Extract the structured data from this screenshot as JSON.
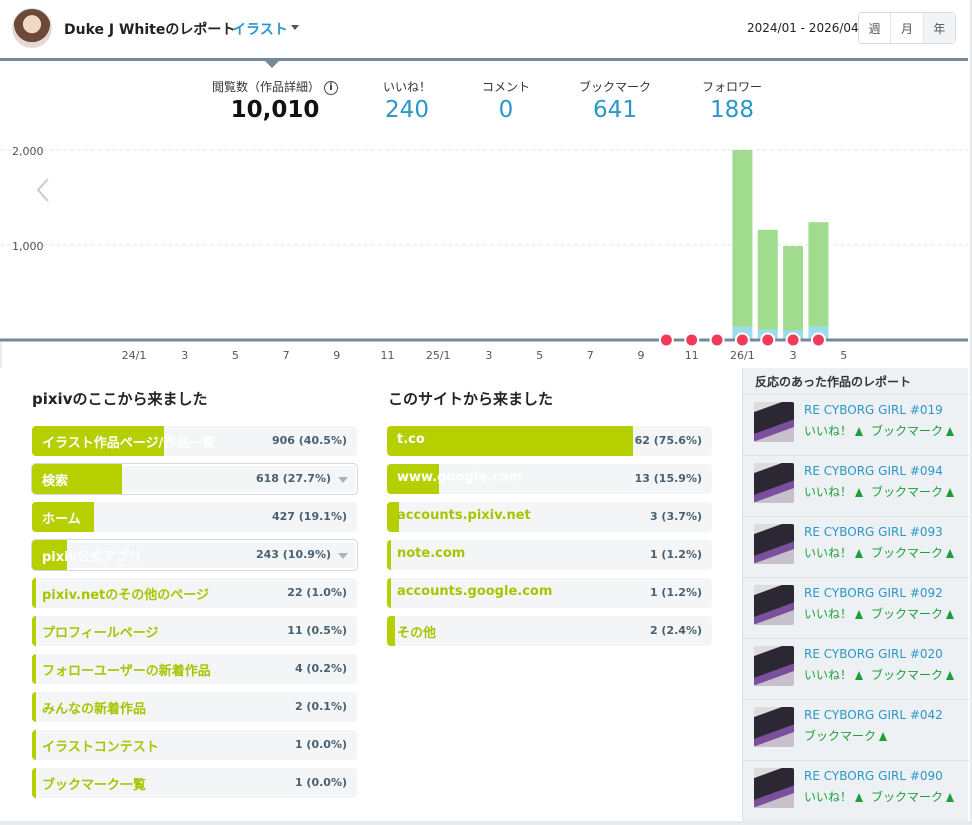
{
  "header": {
    "report_title": "Duke J Whiteのレポート",
    "category": "イラスト",
    "date_range": "2024/01 - 2026/04",
    "period_buttons": [
      "週",
      "月",
      "年"
    ],
    "active_period": "年"
  },
  "summary": {
    "views_label": "閲覧数（作品詳細）",
    "views_value": "10,010",
    "likes_label": "いいね！",
    "likes_value": "240",
    "comments_label": "コメント",
    "comments_value": "0",
    "bookmarks_label": "ブックマーク",
    "bookmarks_value": "641",
    "followers_label": "フォロワー",
    "followers_value": "188"
  },
  "chart_data": {
    "type": "bar",
    "ylim": [
      0,
      2000
    ],
    "y_ticks": [
      "2,000",
      "1,000"
    ],
    "y_tick_values": [
      2000,
      1000
    ],
    "x_tick_labels": [
      "24/1",
      "3",
      "5",
      "7",
      "9",
      "11",
      "25/1",
      "3",
      "5",
      "7",
      "9",
      "11",
      "26/1",
      "3",
      "5"
    ],
    "categories": [
      "25/11",
      "25/12",
      "26/1",
      "26/2",
      "26/3",
      "26/4"
    ],
    "series": [
      {
        "values": [
          0,
          0,
          2000,
          1160,
          990,
          1240
        ],
        "color": "#a0db8e"
      },
      {
        "values": [
          0,
          0,
          140,
          110,
          100,
          140
        ],
        "color": "#9bdcf0"
      }
    ],
    "grid": true,
    "event_markers": [
      "25/10",
      "25/11",
      "25/12",
      "26/1",
      "26/2",
      "26/3",
      "26/4"
    ],
    "marker_color": "#f03c5a"
  },
  "referrers_pixiv": {
    "title": "pixivのここから来ました",
    "rows": [
      {
        "label": "イラスト作品ページ/作品一覧",
        "stat": "906 (40.5%)",
        "pct": 40.5,
        "caret": false
      },
      {
        "label": "検索",
        "stat": "618 (27.7%)",
        "pct": 27.7,
        "caret": true
      },
      {
        "label": "ホーム",
        "stat": "427 (19.1%)",
        "pct": 19.1,
        "caret": false
      },
      {
        "label": "pixiv公式アプリ",
        "stat": "243 (10.9%)",
        "pct": 10.9,
        "caret": true
      },
      {
        "label": "pixiv.netのその他のページ",
        "stat": "22 (1.0%)",
        "pct": 1.0,
        "caret": false
      },
      {
        "label": "プロフィールページ",
        "stat": "11 (0.5%)",
        "pct": 0.5,
        "caret": false
      },
      {
        "label": "フォローユーザーの新着作品",
        "stat": "4 (0.2%)",
        "pct": 0.2,
        "caret": false
      },
      {
        "label": "みんなの新着作品",
        "stat": "2 (0.1%)",
        "pct": 0.1,
        "caret": false
      },
      {
        "label": "イラストコンテスト",
        "stat": "1 (0.0%)",
        "pct": 0.0,
        "caret": false
      },
      {
        "label": "ブックマーク一覧",
        "stat": "1 (0.0%)",
        "pct": 0.0,
        "caret": false
      }
    ]
  },
  "referrers_sites": {
    "title": "このサイトから来ました",
    "rows": [
      {
        "label": "t.co",
        "stat": "62 (75.6%)",
        "pct": 75.6
      },
      {
        "label": "www.google.com",
        "stat": "13 (15.9%)",
        "pct": 15.9
      },
      {
        "label": "accounts.pixiv.net",
        "stat": "3 (3.7%)",
        "pct": 3.7
      },
      {
        "label": "note.com",
        "stat": "1 (1.2%)",
        "pct": 1.2
      },
      {
        "label": "accounts.google.com",
        "stat": "1 (1.2%)",
        "pct": 1.2
      },
      {
        "label": "その他",
        "stat": "2 (2.4%)",
        "pct": 2.4
      }
    ]
  },
  "works": {
    "title": "反応のあった作品のレポート",
    "items": [
      {
        "title": "RE CYBORG GIRL #019",
        "badges": [
          "いいね！",
          "ブックマーク"
        ]
      },
      {
        "title": "RE CYBORG GIRL #094",
        "badges": [
          "いいね！",
          "ブックマーク"
        ]
      },
      {
        "title": "RE CYBORG GIRL #093",
        "badges": [
          "いいね！",
          "ブックマーク"
        ]
      },
      {
        "title": "RE CYBORG GIRL #092",
        "badges": [
          "いいね！",
          "ブックマーク"
        ]
      },
      {
        "title": "RE CYBORG GIRL #020",
        "badges": [
          "いいね！",
          "ブックマーク"
        ]
      },
      {
        "title": "RE CYBORG GIRL #042",
        "badges": [
          "ブックマーク"
        ]
      },
      {
        "title": "RE CYBORG GIRL #090",
        "badges": [
          "いいね！",
          "ブックマーク"
        ]
      }
    ]
  },
  "colors": {
    "accent": "#2a97c8",
    "bar_fill": "#b5cf00",
    "bar_text_light": "#ffffff",
    "bar_text_dark": "#a8c400",
    "up_arrow": "#1e9e3a",
    "header_rule": "#74899b"
  }
}
